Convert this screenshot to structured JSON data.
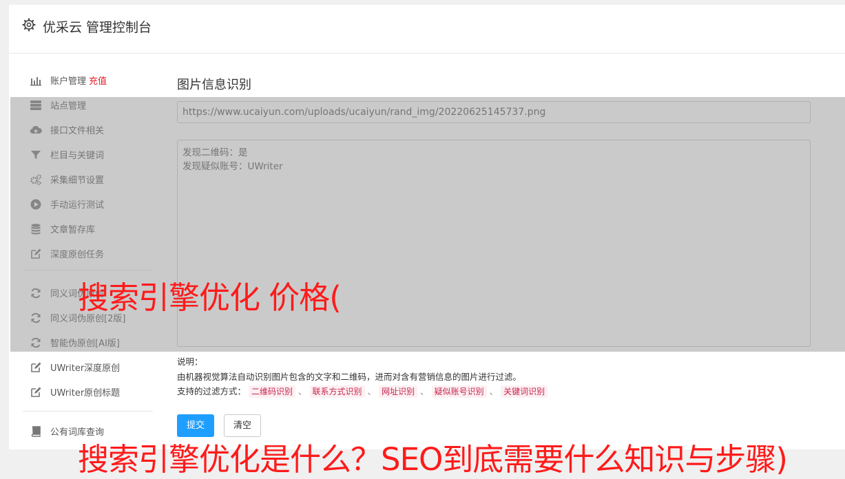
{
  "header": {
    "title": "优采云 管理控制台"
  },
  "sidebar": {
    "items": [
      {
        "label": "账户管理",
        "accent": "充值",
        "icon": "bar-chart-icon"
      },
      {
        "label": "站点管理",
        "icon": "server-icon"
      },
      {
        "label": "接口文件相关",
        "icon": "cloud-upload-icon"
      },
      {
        "label": "栏目与关键词",
        "icon": "filter-icon"
      },
      {
        "label": "采集细节设置",
        "icon": "gears-icon"
      },
      {
        "label": "手动运行测试",
        "icon": "play-icon"
      },
      {
        "label": "文章暂存库",
        "icon": "database-icon"
      },
      {
        "label": "深度原创任务",
        "icon": "edit-icon"
      },
      {
        "label": "同义词伪原创",
        "icon": "refresh-icon"
      },
      {
        "label": "同义词伪原创[2版]",
        "icon": "refresh-icon"
      },
      {
        "label": "智能伪原创[AI版]",
        "icon": "refresh-icon"
      },
      {
        "label": "UWriter深度原创",
        "icon": "edit-icon"
      },
      {
        "label": "UWriter原创标题",
        "icon": "edit-icon"
      },
      {
        "label": "公有词库查询",
        "icon": "book-icon"
      }
    ]
  },
  "main": {
    "section_title": "图片信息识别",
    "url_value": "https://www.ucaiyun.com/uploads/ucaiyun/rand_img/20220625145737.png",
    "result_lines": [
      "发现二维码：是",
      "发现疑似账号：UWriter"
    ],
    "desc_label": "说明：",
    "desc_text": "由机器视觉算法自动识别图片包含的文字和二维码，进而对含有营销信息的图片进行过滤。",
    "filter_label": "支持的过滤方式：",
    "filter_tags": [
      "二维码识别",
      "联系方式识别",
      "网址识别",
      "疑似账号识别",
      "关键词识别"
    ],
    "tag_separator": "、",
    "submit_label": "提交",
    "clear_label": "清空"
  },
  "watermark": {
    "line1": "搜索引擎优化 价格(",
    "line2": "搜索引擎优化是什么？SEO到底需要什么知识与步骤)"
  },
  "colors": {
    "accent": "#e51c23",
    "primary": "#1e9fff",
    "tag_text": "#c7254e",
    "tag_bg": "#fdf0f3",
    "watermark": "#ff1a1a"
  }
}
